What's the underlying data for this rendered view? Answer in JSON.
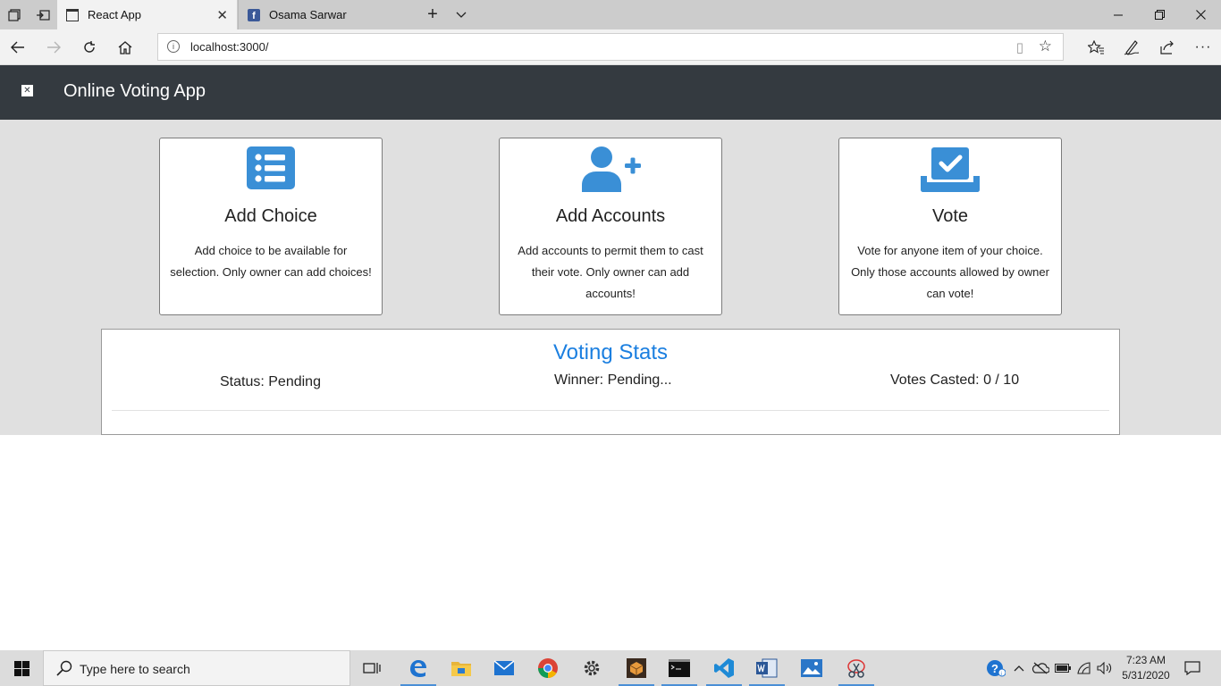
{
  "browser": {
    "tabs": [
      {
        "title": "React App",
        "active": true
      },
      {
        "title": "Osama Sarwar",
        "active": false
      }
    ],
    "url": "localhost:3000/"
  },
  "app": {
    "title": "Online Voting App"
  },
  "cards": [
    {
      "icon": "list-icon",
      "title": "Add Choice",
      "text": "Add choice to be available for selection. Only owner can add choices!"
    },
    {
      "icon": "user-plus-icon",
      "title": "Add Accounts",
      "text": "Add accounts to permit them to cast their vote. Only owner can add accounts!"
    },
    {
      "icon": "vote-box-icon",
      "title": "Vote",
      "text": "Vote for anyone item of your choice. Only those accounts allowed by owner can vote!"
    }
  ],
  "stats": {
    "title": "Voting Stats",
    "status": "Status: Pending",
    "winner": "Winner: Pending...",
    "votes": "Votes Casted: 0 / 10"
  },
  "taskbar": {
    "search_placeholder": "Type here to search",
    "time": "7:23 AM",
    "date": "5/31/2020"
  },
  "colors": {
    "accent": "#3a8fd6",
    "header_bg": "#343a40",
    "stats_title": "#1b7fe0"
  }
}
